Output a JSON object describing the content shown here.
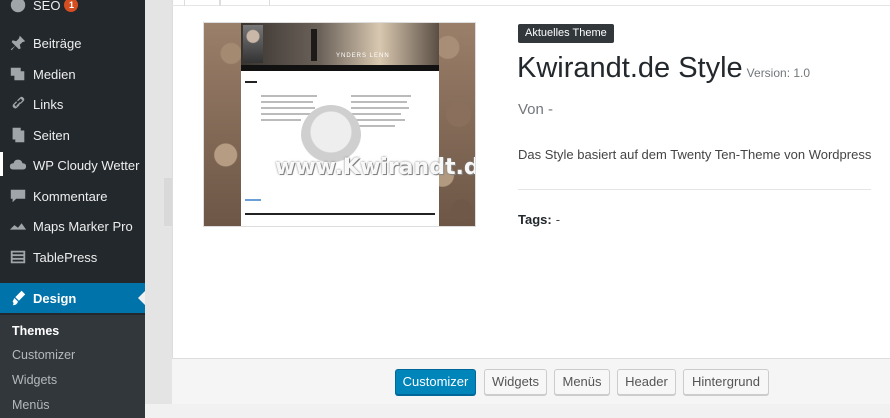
{
  "sidebar": {
    "items": [
      {
        "label": "SEO",
        "icon": "seo-icon",
        "badge": "1"
      },
      {
        "label": "Beiträge",
        "icon": "pin-icon"
      },
      {
        "label": "Medien",
        "icon": "media-icon"
      },
      {
        "label": "Links",
        "icon": "link-icon"
      },
      {
        "label": "Seiten",
        "icon": "pages-icon"
      },
      {
        "label": "WP Cloudy Wetter",
        "icon": "cloud-icon"
      },
      {
        "label": "Kommentare",
        "icon": "comment-icon"
      },
      {
        "label": "Maps Marker Pro",
        "icon": "map-marker-icon"
      },
      {
        "label": "TablePress",
        "icon": "table-icon"
      },
      {
        "label": "Design",
        "icon": "brush-icon"
      }
    ],
    "submenu": [
      {
        "label": "Themes"
      },
      {
        "label": "Customizer"
      },
      {
        "label": "Widgets"
      },
      {
        "label": "Menüs"
      }
    ]
  },
  "screenshot": {
    "watermark": "www.Kwirandt.de",
    "brand": "YNDERS LENN"
  },
  "theme": {
    "current_badge": "Aktuelles Theme",
    "name": "Kwirandt.de Style",
    "version": "Version: 1.0",
    "author": "Von -",
    "description": "Das Style basiert auf dem Twenty Ten-Theme von Wordpress",
    "tags_label": "Tags:",
    "tags_value": "-"
  },
  "actions": {
    "customizer": "Customizer",
    "widgets": "Widgets",
    "menus": "Menüs",
    "header": "Header",
    "background": "Hintergrund"
  },
  "colors": {
    "sidebar_bg": "#23282d",
    "active_menu": "#0073aa",
    "primary_button": "#0085ba",
    "badge": "#d54e21"
  }
}
